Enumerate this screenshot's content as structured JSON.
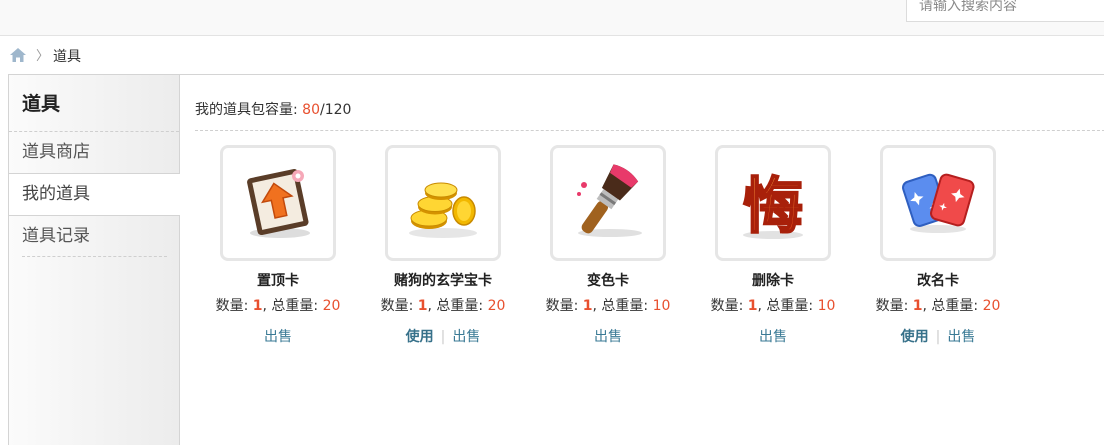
{
  "header": {
    "search_placeholder": "请输入搜索内容"
  },
  "breadcrumb": {
    "current": "道具",
    "separator": "〉"
  },
  "sidebar": {
    "title": "道具",
    "items": [
      {
        "label": "道具商店",
        "active": false
      },
      {
        "label": "我的道具",
        "active": true
      },
      {
        "label": "道具记录",
        "active": false
      }
    ]
  },
  "capacity": {
    "label": "我的道具包容量: ",
    "used": "80",
    "total": "/120"
  },
  "labels": {
    "quantity": "数量: ",
    "weight": ", 总重量: ",
    "use": "使用",
    "sell": "出售",
    "sep": "|"
  },
  "items": [
    {
      "name": "置顶卡",
      "quantity": "1",
      "weight": "20",
      "icon": "pin-to-top-card-icon"
    },
    {
      "name": "赌狗的玄学宝卡",
      "quantity": "1",
      "weight": "20",
      "icon": "gold-coins-icon"
    },
    {
      "name": "变色卡",
      "quantity": "1",
      "weight": "10",
      "icon": "paintbrush-icon"
    },
    {
      "name": "删除卡",
      "quantity": "1",
      "weight": "10",
      "icon": "hui-character-icon"
    },
    {
      "name": "改名卡",
      "quantity": "1",
      "weight": "20",
      "icon": "playing-cards-icon"
    }
  ],
  "colors": {
    "accent": "#e8502f",
    "link": "#3a7a95"
  }
}
